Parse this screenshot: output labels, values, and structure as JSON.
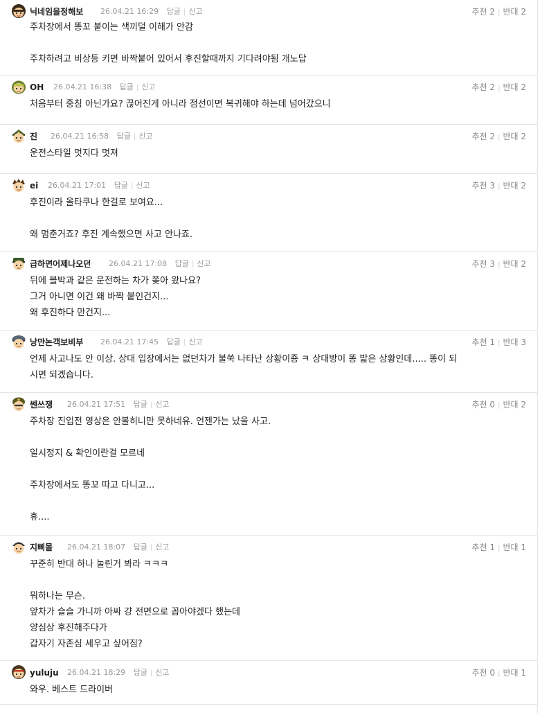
{
  "labels": {
    "reply": "답글",
    "report": "신고",
    "up": "추천",
    "down": "반대"
  },
  "comments": [
    {
      "nick": "닉네임을정해보",
      "date": "26.04.21 16:29",
      "up": "2",
      "down": "2",
      "text": "주차장에서 똥꼬 붙이는 색끼덜 이해가 안감\n\n주차하려고 비상등 키면 바짝붙어 있어서 후진할때까지 기다려야됨 개노답"
    },
    {
      "nick": "OH",
      "date": "26.04.21 16:38",
      "up": "2",
      "down": "2",
      "text": "처음부터 중침 아닌가요? 끊어진게 아니라 점선이면 복귀해야 하는데 넘어갔으니"
    },
    {
      "nick": "진",
      "date": "26.04.21 16:58",
      "up": "2",
      "down": "2",
      "text": "운전스타일 멋지다 멋져"
    },
    {
      "nick": "ei",
      "date": "26.04.21 17:01",
      "up": "3",
      "down": "2",
      "text": "후진이라 올타쿠나 한걸로 보여요...\n\n왜 멈춘거죠? 후진 계속했으면 사고 안나죠."
    },
    {
      "nick": "급하면어제나오던",
      "date": "26.04.21 17:08",
      "up": "3",
      "down": "2",
      "text": "뒤에 블박과 같은 운전하는 차가 쫒아 왔나요?\n그거 아니면 이건 왜 바짝 붙인건지...\n왜 후진하다 만건지..."
    },
    {
      "nick": "낭만논객보비부",
      "date": "26.04.21 17:45",
      "up": "1",
      "down": "3",
      "text": "언제 사고나도 안 이상. 상대 입장에서는 없던차가 불쑥 나타난 상황이죵 ㅋ 상대방이 똥 밟은 상황인데..... 똥이 되\n시면 되겠습니다."
    },
    {
      "nick": "쎈쓰쟁",
      "date": "26.04.21 17:51",
      "up": "0",
      "down": "2",
      "text": "주차장 진입전 영상은 안볼히니만 못하네유. 언젠가는 났을 사고.\n\n일시정지 & 확인이란걸 모르네\n\n주차장에서도 똥꼬 따고 다니고...\n\n휴...."
    },
    {
      "nick": "지삐몰",
      "date": "26.04.21 18:07",
      "up": "1",
      "down": "1",
      "text": "꾸준히 반대 하나 눌린거 봐라 ㅋㅋㅋ\n\n뭐하나는 무슨.\n앞차가 슬슬 가니까 아싸 걍 전면으로 꼽아야겠다 했는데\n양심상 후진해주다가\n갑자기 자존심 세우고 싶어짐?"
    },
    {
      "nick": "yuluju",
      "date": "26.04.21 18:29",
      "up": "0",
      "down": "1",
      "text": "와우. 베스트 드라이버"
    }
  ]
}
